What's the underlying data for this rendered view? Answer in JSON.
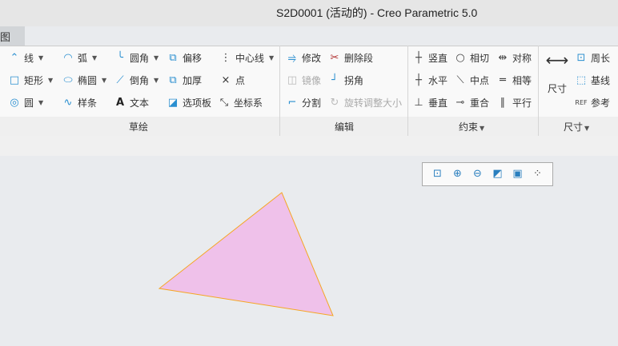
{
  "window": {
    "title": "S2D0001 (活动的) - Creo Parametric 5.0"
  },
  "tab": {
    "label": "图"
  },
  "groups": {
    "sketch": {
      "label": "草绘",
      "items": [
        "线",
        "弧",
        "圆角",
        "偏移",
        "中心线",
        "矩形",
        "椭圆",
        "倒角",
        "加厚",
        "点",
        "圆",
        "样条",
        "文本",
        "选项板",
        "坐标系"
      ]
    },
    "edit": {
      "label": "编辑",
      "items": [
        "修改",
        "删除段",
        "镜像",
        "拐角",
        "分割",
        "旋转调整大小"
      ]
    },
    "constrain": {
      "label": "约束",
      "items": [
        "竖直",
        "相切",
        "对称",
        "水平",
        "中点",
        "相等",
        "垂直",
        "重合",
        "平行"
      ]
    },
    "dimension": {
      "label": "尺寸",
      "items": [
        "尺寸",
        "周长",
        "基线",
        "参考"
      ]
    }
  },
  "sketch_shape": {
    "type": "triangle",
    "fill": "#efc1ea",
    "stroke": "#f5a623"
  }
}
